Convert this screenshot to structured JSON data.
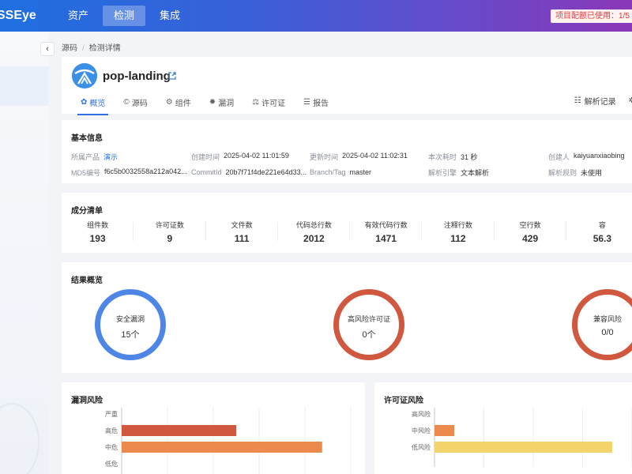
{
  "app": {
    "logo": "SSEye",
    "nav": [
      {
        "label": "资产",
        "active": false
      },
      {
        "label": "检测",
        "active": true
      },
      {
        "label": "集成",
        "active": false
      }
    ],
    "quota": "项目配额已使用：1/5"
  },
  "breadcrumb": [
    "源码",
    "检测详情"
  ],
  "project": {
    "name": "pop-landing",
    "tabs": [
      {
        "icon": "✿",
        "label": "概览",
        "active": true
      },
      {
        "icon": "©",
        "label": "源码",
        "active": false
      },
      {
        "icon": "⚙",
        "label": "组件",
        "active": false
      },
      {
        "icon": "✹",
        "label": "漏洞",
        "active": false
      },
      {
        "icon": "⚖",
        "label": "许可证",
        "active": false
      },
      {
        "icon": "☰",
        "label": "报告",
        "active": false
      }
    ],
    "actions": [
      {
        "icon": "☷",
        "label": "解析记录"
      },
      {
        "icon": "✲",
        "label": ""
      }
    ]
  },
  "basic_info": {
    "title": "基本信息",
    "rows": [
      [
        {
          "label": "所属产品",
          "value": "演示",
          "link": true
        },
        {
          "label": "创建时间",
          "value": "2025-04-02 11:01:59"
        },
        {
          "label": "更新时间",
          "value": "2025-04-02 11:02:31"
        },
        {
          "label": "本次耗时",
          "value": "31 秒"
        },
        {
          "label": "创建人",
          "value": "kaiyuanxiaobing"
        }
      ],
      [
        {
          "label": "MD5编号",
          "value": "f6c5b0032558a212a042..."
        },
        {
          "label": "CommitId",
          "value": "20b7f71f4de221e64d33..."
        },
        {
          "label": "Branch/Tag",
          "value": "master"
        },
        {
          "label": "解析引擎",
          "value": "文本解析"
        },
        {
          "label": "解析规则",
          "value": "未使用"
        }
      ]
    ]
  },
  "composition": {
    "title": "成分清单",
    "stats": [
      {
        "label": "组件数",
        "value": "193"
      },
      {
        "label": "许可证数",
        "value": "9"
      },
      {
        "label": "文件数",
        "value": "111"
      },
      {
        "label": "代码总行数",
        "value": "2012"
      },
      {
        "label": "有效代码行数",
        "value": "1471"
      },
      {
        "label": "注释行数",
        "value": "112"
      },
      {
        "label": "空行数",
        "value": "429"
      },
      {
        "label": "容",
        "value": "56.3"
      }
    ]
  },
  "results": {
    "title": "结果概览",
    "rings": [
      {
        "label": "安全漏洞",
        "value": "15个",
        "color": "#4e86e6"
      },
      {
        "label": "高风险许可证",
        "value": "0个",
        "color": "#d0583f"
      },
      {
        "label": "兼容风险",
        "value": "0/0",
        "color": "#d0583f"
      }
    ]
  },
  "vuln_risk": {
    "title": "漏洞风险",
    "colors": {
      "严重": "#d0583f",
      "高危": "#d0583f",
      "中危": "#eb8a4c",
      "低危": "#f5d36b"
    }
  },
  "license_risk": {
    "title": "许可证风险",
    "colors": {
      "高风险": "#d0583f",
      "中风险": "#eb8a4c",
      "低风险": "#f5d36b"
    }
  },
  "chart_data": [
    {
      "type": "bar",
      "title": "漏洞风险",
      "orientation": "horizontal",
      "categories": [
        "严重",
        "高危",
        "中危",
        "低危"
      ],
      "values": [
        0,
        4,
        7,
        0
      ],
      "xlim": [
        0,
        8
      ]
    },
    {
      "type": "bar",
      "title": "许可证风险",
      "orientation": "horizontal",
      "categories": [
        "高风险",
        "中风险",
        "低风险"
      ],
      "values": [
        0,
        1,
        9
      ],
      "xlim": [
        0,
        10
      ]
    }
  ]
}
